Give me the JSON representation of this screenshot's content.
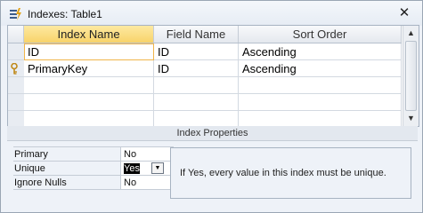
{
  "window": {
    "title": "Indexes: Table1",
    "close_glyph": "✕",
    "title_icon": "index-lightning-icon"
  },
  "grid": {
    "columns": [
      "Index Name",
      "Field Name",
      "Sort Order"
    ],
    "rows": [
      {
        "index_name": "ID",
        "field_name": "ID",
        "sort_order": "Ascending",
        "primary_key": false
      },
      {
        "index_name": "PrimaryKey",
        "field_name": "ID",
        "sort_order": "Ascending",
        "primary_key": true
      },
      {
        "index_name": "",
        "field_name": "",
        "sort_order": "",
        "primary_key": false
      },
      {
        "index_name": "",
        "field_name": "",
        "sort_order": "",
        "primary_key": false
      },
      {
        "index_name": "",
        "field_name": "",
        "sort_order": "",
        "primary_key": false
      }
    ]
  },
  "index_properties": {
    "header": "Index Properties",
    "properties": [
      {
        "label": "Primary",
        "value": "No"
      },
      {
        "label": "Unique",
        "value": "Yes"
      },
      {
        "label": "Ignore Nulls",
        "value": "No"
      }
    ],
    "help_text": "If Yes, every value in this index must be unique."
  },
  "icons": {
    "primary_key_icon": "key-icon",
    "scroll_up_icon": "scroll-up-icon",
    "scroll_down_icon": "scroll-down-icon",
    "dropdown_icon": "dropdown-arrow-icon"
  },
  "colors": {
    "header_active": "#f8d36a",
    "window_bg": "#eef2f8",
    "grid_border": "#a7b3c2"
  }
}
